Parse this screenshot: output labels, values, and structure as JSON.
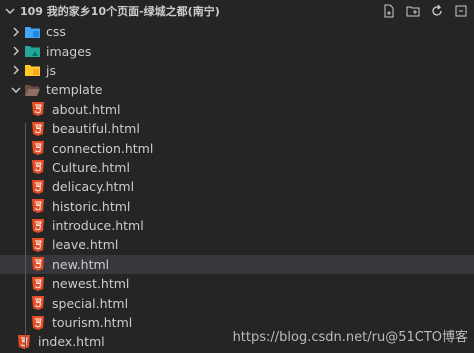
{
  "header": {
    "title": "109 我的家乡10个页面-绿城之都(南宁)",
    "actions": [
      "new-file-icon",
      "new-folder-icon",
      "refresh-icon",
      "collapse-all-icon"
    ]
  },
  "tree": {
    "folders": {
      "css": "css",
      "images": "images",
      "js": "js",
      "template": "template"
    },
    "template_files": [
      "about.html",
      "beautiful.html",
      "connection.html",
      "Culture.html",
      "delicacy.html",
      "historic.html",
      "introduce.html",
      "leave.html",
      "new.html",
      "newest.html",
      "special.html",
      "tourism.html"
    ],
    "root_file": "index.html",
    "selected": "new.html"
  },
  "watermark": "https://blog.csdn.net/ru@51CTO博客",
  "colors": {
    "background": "#252526",
    "selection": "#37373d",
    "html_icon": "#e44d26",
    "css_folder": "#42a5f5",
    "images_folder": "#26a69a",
    "js_folder": "#ffca28",
    "template_folder": "#8d6e63"
  }
}
